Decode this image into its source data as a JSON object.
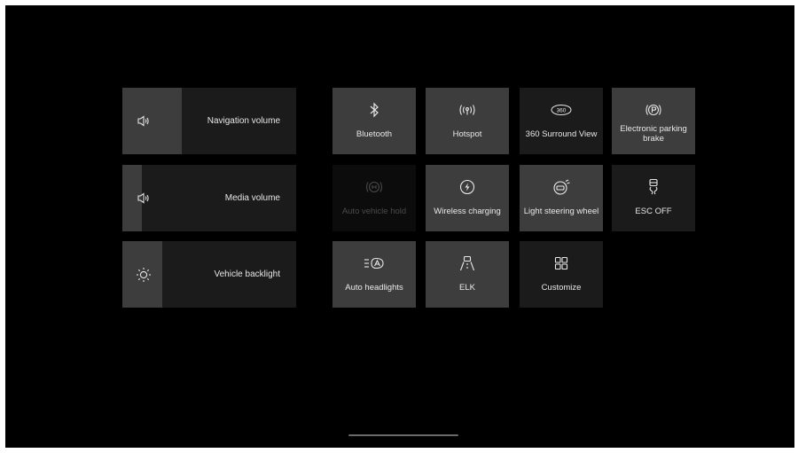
{
  "sliders": [
    {
      "label": "Navigation volume",
      "icon": "speaker-icon",
      "level_percent": 34
    },
    {
      "label": "Media volume",
      "icon": "speaker-icon",
      "level_percent": 11
    },
    {
      "label": "Vehicle backlight",
      "icon": "brightness-icon",
      "level_percent": 23
    }
  ],
  "tiles": {
    "bluetooth": {
      "label": "Bluetooth",
      "icon": "bluetooth-icon",
      "state": "active"
    },
    "hotspot": {
      "label": "Hotspot",
      "icon": "hotspot-icon",
      "state": "active"
    },
    "surround_view": {
      "label": "360 Surround View",
      "icon": "360-view-icon",
      "icon_text": "360",
      "state": "inactive"
    },
    "parking_brake": {
      "label": "Electronic parking brake",
      "icon": "parking-brake-icon",
      "state": "active"
    },
    "auto_vehicle_hold": {
      "label": "Auto vehicle hold",
      "icon": "auto-hold-icon",
      "state": "disabled"
    },
    "wireless_charging": {
      "label": "Wireless charging",
      "icon": "wireless-charging-icon",
      "state": "active"
    },
    "light_steering": {
      "label": "Light steering wheel",
      "icon": "steering-wheel-icon",
      "state": "active"
    },
    "esc_off": {
      "label": "ESC OFF",
      "icon": "esc-off-icon",
      "state": "inactive"
    },
    "auto_headlights": {
      "label": "Auto headlights",
      "icon": "auto-headlights-icon",
      "state": "active"
    },
    "elk": {
      "label": "ELK",
      "icon": "lane-keep-icon",
      "state": "active"
    },
    "customize": {
      "label": "Customize",
      "icon": "grid-icon",
      "state": "inactive"
    }
  },
  "colors": {
    "background": "#000000",
    "tile_inactive": "#1b1b1b",
    "tile_active": "#3d3d3d",
    "text": "#e8e8e8",
    "text_disabled": "#4a4a4a"
  }
}
